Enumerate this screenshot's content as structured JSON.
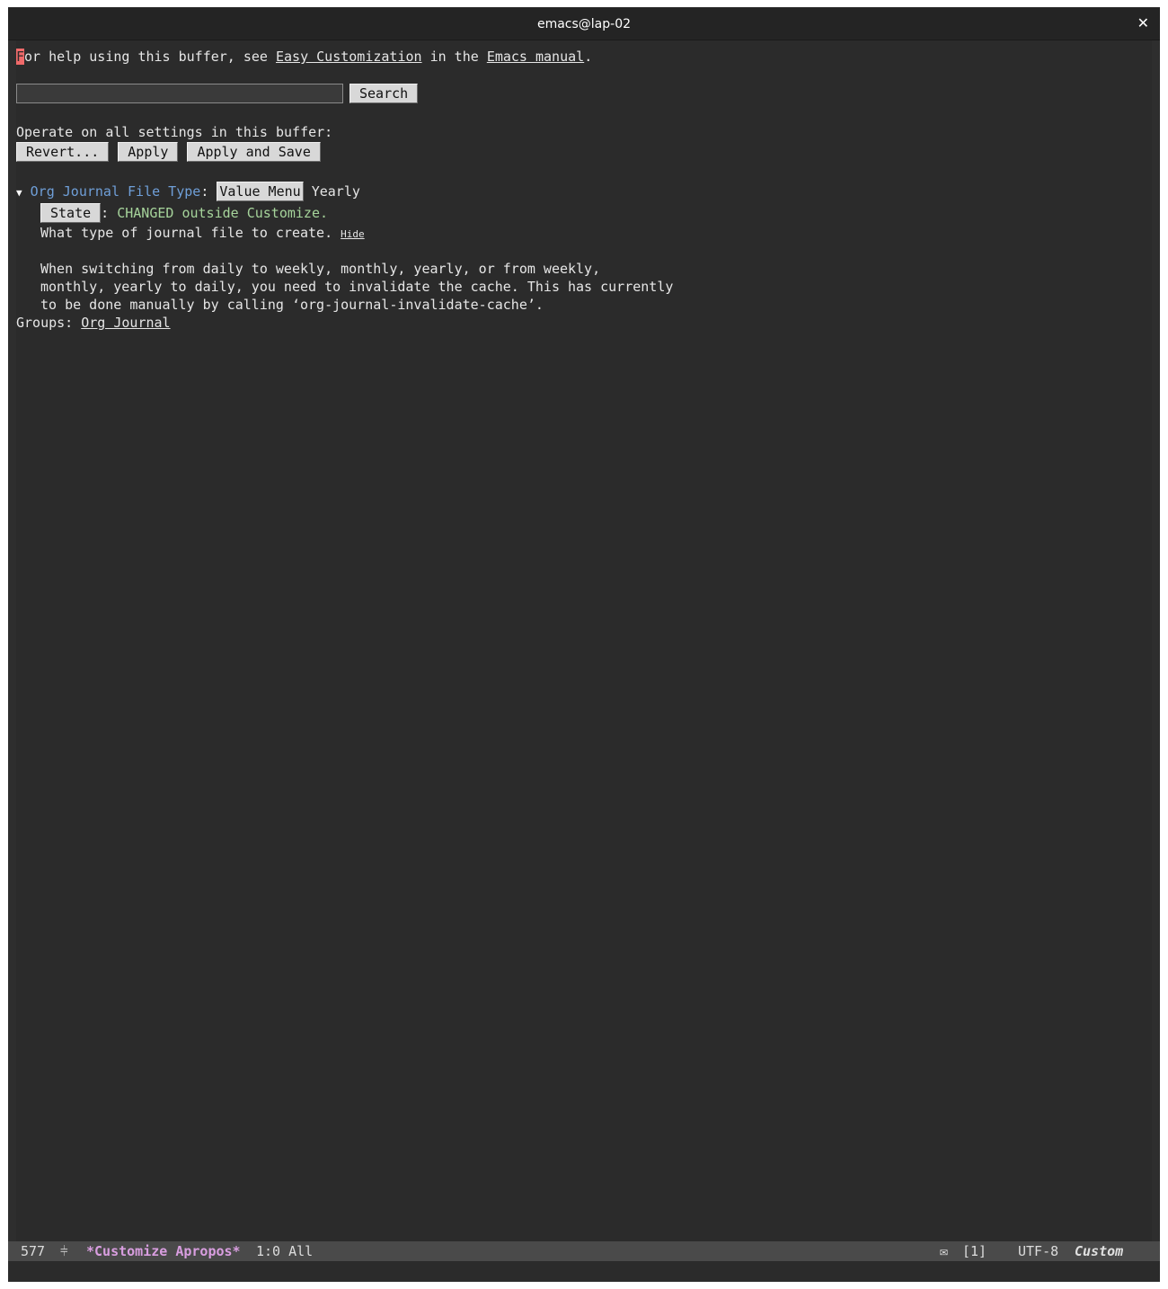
{
  "window": {
    "title": "emacs@lap-02",
    "close_glyph": "✕"
  },
  "help_line": {
    "cursor_char": "F",
    "part1": "or help using this buffer, see ",
    "easy_link": "Easy Customization",
    "part2": " in the ",
    "manual_link": "Emacs manual",
    "part3": "."
  },
  "search": {
    "value": "",
    "button": "Search"
  },
  "operate": {
    "label": "Operate on all settings in this buffer:",
    "revert": "Revert...",
    "apply": "Apply",
    "apply_save": "Apply and Save"
  },
  "option": {
    "triangle": "▼",
    "name": "Org Journal File Type",
    "colon": ":",
    "value_menu": "Value Menu",
    "value": "Yearly",
    "state_button": "State",
    "state_sep": ":",
    "state_text": "CHANGED outside Customize.",
    "doc_short": "What type of journal file to create.",
    "hide": "Hide",
    "doc_lines": [
      "When switching from daily to weekly, monthly, yearly, or from weekly,",
      "monthly, yearly to daily, you need to invalidate the cache. This has currently",
      "to be done manually by calling ‘org-journal-invalidate-cache’."
    ],
    "groups_label": "Groups:",
    "group_link": "Org Journal"
  },
  "modeline": {
    "line_count": "577",
    "mode_icon": "sliders-icon",
    "mode_glyph": "⫩",
    "buffer_name": "*Customize Apropos*",
    "position": "1:0 All",
    "mail_glyph": "✉",
    "mail_count": "[1]",
    "encoding": "UTF-8",
    "major_mode": "Custom"
  }
}
